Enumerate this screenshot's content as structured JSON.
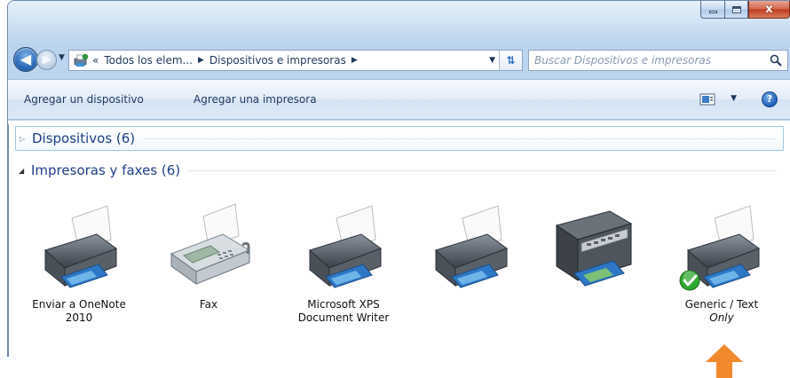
{
  "window": {
    "caption": {
      "minimize_glyph": "minimize-icon",
      "maximize_glyph": "maximize-icon",
      "close_label": "x"
    }
  },
  "navigation": {
    "back_icon": "back-arrow-icon",
    "forward_icon": "forward-arrow-icon",
    "breadcrumb_overflow": "«",
    "breadcrumbs": [
      {
        "label": "Todos los elem..."
      },
      {
        "label": "Dispositivos e impresoras"
      }
    ],
    "search_placeholder": "Buscar Dispositivos e impresoras"
  },
  "command_bar": {
    "add_device_label": "Agregar un dispositivo",
    "add_printer_label": "Agregar una impresora",
    "help_label": "?"
  },
  "groups": {
    "devices": {
      "label": "Dispositivos (6)",
      "expanded": false
    },
    "printers": {
      "label": "Impresoras y faxes (6)",
      "expanded": true
    }
  },
  "printers": [
    {
      "line1": "Enviar a OneNote",
      "line2": "2010",
      "icon": "printer-icon",
      "default": false
    },
    {
      "line1": "Fax",
      "line2": "",
      "icon": "fax-machine-icon",
      "default": false
    },
    {
      "line1": "Microsoft XPS",
      "line2": "Document Writer",
      "icon": "printer-icon",
      "default": false
    },
    {
      "line1": "",
      "line2": "",
      "icon": "printer-icon",
      "default": false
    },
    {
      "line1": "",
      "line2": "",
      "icon": "multifunction-printer-icon",
      "default": false
    },
    {
      "line1": "Generic / Text",
      "line2": "Only",
      "icon": "printer-icon",
      "default": true
    }
  ],
  "colors": {
    "accent": "#1e3f8a",
    "annotation_arrow": "#f08a2c",
    "default_check": "#2fa82f"
  }
}
